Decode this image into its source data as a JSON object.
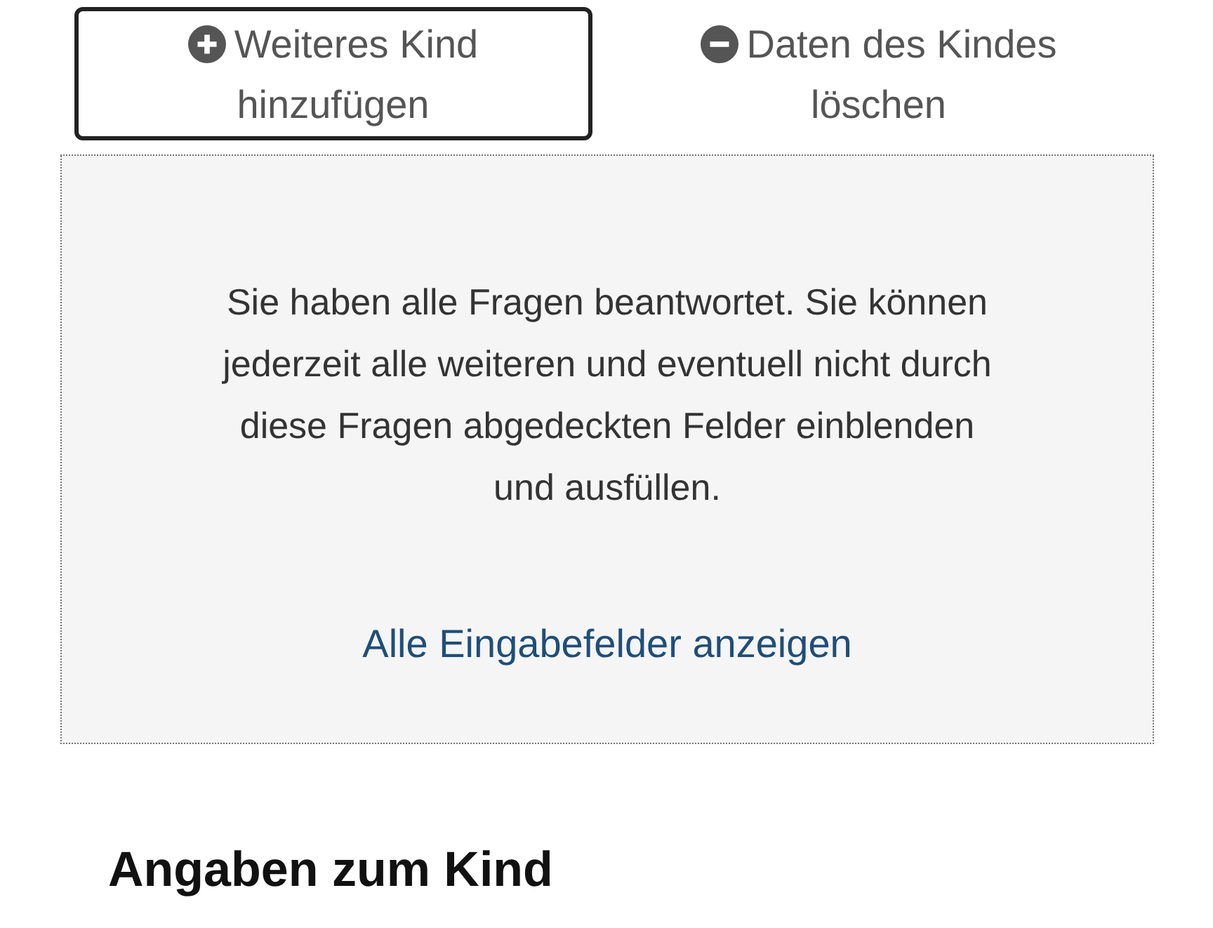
{
  "actions": [
    {
      "kind": "add",
      "label": "Weiteres Kind hinzufügen",
      "focused": true
    },
    {
      "kind": "remove",
      "label": "Daten des Kindes löschen",
      "focused": false
    }
  ],
  "notice": {
    "text": "Sie haben alle Fragen beantwortet. Sie können jederzeit alle weiteren und eventuell nicht durch diese Fragen abgedeckten Felder einblenden und ausfüllen.",
    "link": "Alle Eingabefelder anzeigen"
  },
  "section_heading": "Angaben zum Kind"
}
